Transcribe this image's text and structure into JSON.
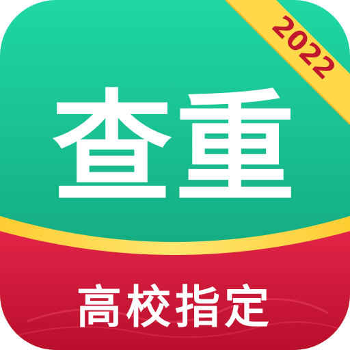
{
  "app_icon": {
    "title": "查重",
    "subtitle": "高校指定",
    "year_badge": "2022",
    "colors": {
      "green_top": "#1ed6a4",
      "green_bottom": "#129c74",
      "yellow_band": "#ffd84a",
      "red_band": "#d71a3b",
      "badge": "#ffd94a",
      "text": "#ffffff",
      "badge_text": "#c2182e"
    }
  }
}
